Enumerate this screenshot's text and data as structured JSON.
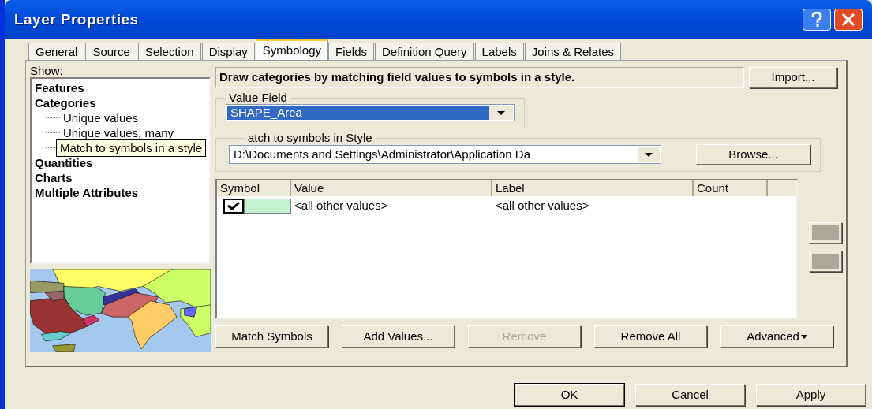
{
  "window": {
    "title": "Layer Properties"
  },
  "tabs": [
    {
      "label": "General",
      "selected": false
    },
    {
      "label": "Source",
      "selected": false
    },
    {
      "label": "Selection",
      "selected": false
    },
    {
      "label": "Display",
      "selected": false
    },
    {
      "label": "Symbology",
      "selected": true
    },
    {
      "label": "Fields",
      "selected": false
    },
    {
      "label": "Definition Query",
      "selected": false
    },
    {
      "label": "Labels",
      "selected": false
    },
    {
      "label": "Joins & Relates",
      "selected": false
    }
  ],
  "show": {
    "label": "Show:",
    "items": [
      {
        "label": "Features"
      },
      {
        "label": "Categories",
        "children": [
          {
            "label": "Unique values"
          },
          {
            "label": "Unique values, many"
          },
          {
            "tooltip": "Match to symbols in a style"
          }
        ]
      },
      {
        "label": "Quantities"
      },
      {
        "label": "Charts"
      },
      {
        "label": "Multiple Attributes"
      }
    ]
  },
  "description": "Draw categories by matching field values to symbols in a style.",
  "import_button": "Import...",
  "value_field": {
    "label": "Value Field",
    "value": "SHAPE_Area"
  },
  "style_group": {
    "label": "atch to symbols in Style",
    "value": "D:\\Documents and Settings\\Administrator\\Application Da",
    "browse": "Browse..."
  },
  "table": {
    "columns": [
      "Symbol",
      "Value",
      "Label",
      "Count"
    ],
    "rows": [
      {
        "checked": true,
        "color": "#c3f2d0",
        "value": "<all other values>",
        "label": "<all other values>",
        "count": ""
      }
    ]
  },
  "actions": [
    {
      "label": "Match Symbols",
      "disabled": false,
      "kind": "plain"
    },
    {
      "label": "Add Values...",
      "disabled": false,
      "kind": "plain"
    },
    {
      "label": "Remove",
      "disabled": true,
      "kind": "plain"
    },
    {
      "label": "Remove All",
      "disabled": false,
      "kind": "plain"
    },
    {
      "label": "Advanced",
      "disabled": false,
      "kind": "menu"
    }
  ],
  "footer": [
    {
      "label": "OK",
      "default": true
    },
    {
      "label": "Cancel",
      "default": false
    },
    {
      "label": "Apply",
      "default": false
    }
  ]
}
